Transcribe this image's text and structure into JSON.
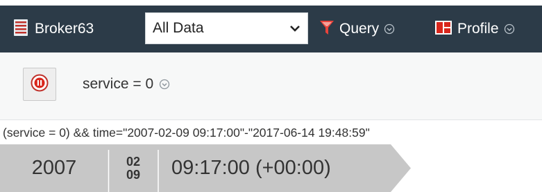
{
  "toolbar": {
    "broker_label": "Broker63",
    "select_value": "All Data",
    "query_label": "Query",
    "profile_label": "Profile"
  },
  "filter": {
    "service_label": "service = 0"
  },
  "query_string": "(service = 0) && time=\"2007-02-09 09:17:00\"-\"2017-06-14 19:48:59\"",
  "timeline": {
    "year": "2007",
    "month": "02",
    "day": "09",
    "time": "09:17:00 (+00:00)"
  },
  "colors": {
    "toolbar_bg": "#2c3b48",
    "filter_icon": "#e8433b",
    "pause_icon": "#c0312b",
    "timeline_bg": "#c7c7c7"
  },
  "icons": {
    "broker": "server-icon",
    "select": "chevron-down-icon",
    "query": "filter-icon",
    "profile": "profile-icon",
    "pause": "pause-icon",
    "dropdown": "circle-chevron-down-icon"
  }
}
